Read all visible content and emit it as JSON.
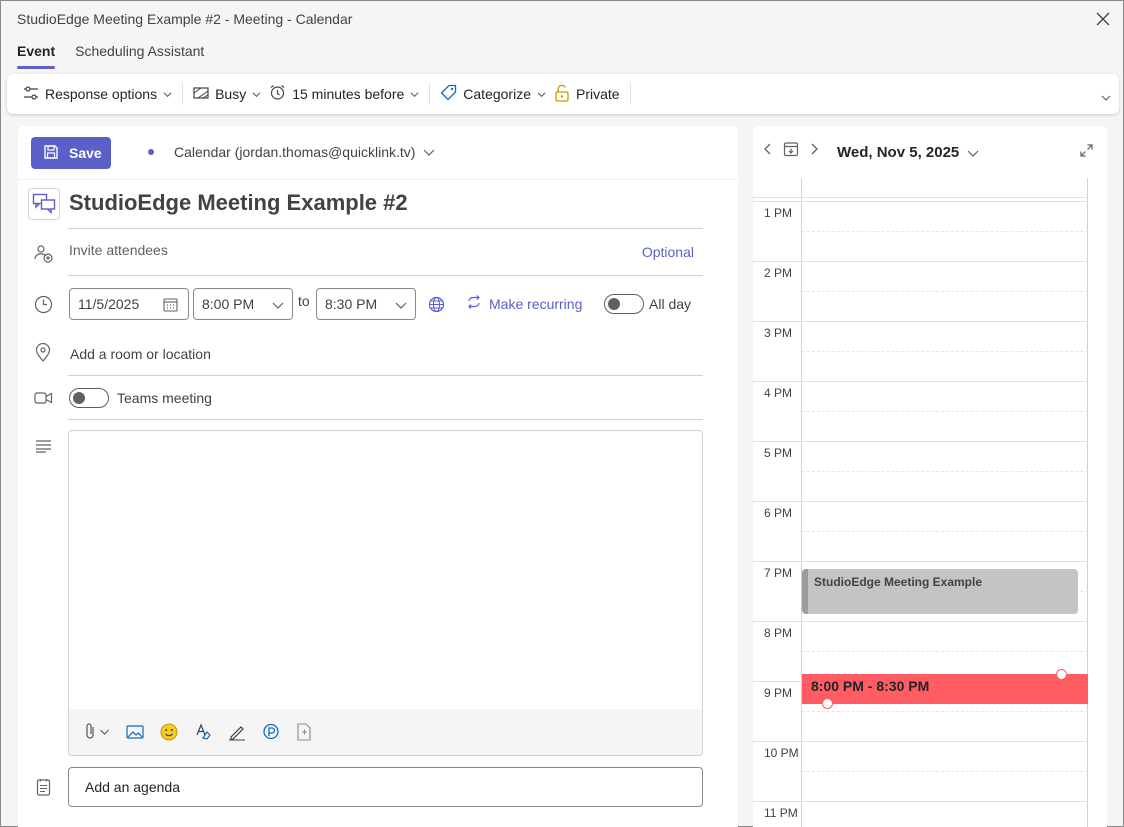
{
  "window": {
    "title": "StudioEdge Meeting Example #2 - Meeting - Calendar"
  },
  "tabs": [
    {
      "label": "Event"
    },
    {
      "label": "Scheduling Assistant"
    }
  ],
  "ribbon": {
    "response_options": "Response options",
    "busy": "Busy",
    "reminder": "15 minutes before",
    "categorize": "Categorize",
    "private": "Private"
  },
  "form": {
    "save": "Save",
    "calendar": "Calendar (jordan.thomas@quicklink.tv)",
    "title": "StudioEdge Meeting Example #2",
    "invite_placeholder": "Invite attendees",
    "optional": "Optional",
    "start_date": "11/5/2025",
    "start_time": "8:00 PM",
    "to": "to",
    "end_time": "8:30 PM",
    "make_recurring": "Make recurring",
    "all_day": "All day",
    "location_placeholder": "Add a room or location",
    "teams_meeting": "Teams meeting",
    "agenda_placeholder": "Add an agenda"
  },
  "day_view": {
    "date": "Wed, Nov 5, 2025",
    "hours": [
      "1 PM",
      "2 PM",
      "3 PM",
      "4 PM",
      "5 PM",
      "6 PM",
      "7 PM",
      "8 PM",
      "9 PM",
      "10 PM",
      "11 PM"
    ],
    "events": [
      {
        "title": "StudioEdge Meeting Example",
        "start": "6:15 PM",
        "end": "7:00 PM",
        "color": "#c4c4c4"
      },
      {
        "title": "8:00 PM - 8:30 PM",
        "start": "8:00 PM",
        "end": "8:30 PM",
        "color": "#ff5c64"
      }
    ]
  },
  "colors": {
    "accent": "#5b5fc7",
    "new_event": "#ff5c64",
    "existing_event": "#c4c4c4"
  }
}
